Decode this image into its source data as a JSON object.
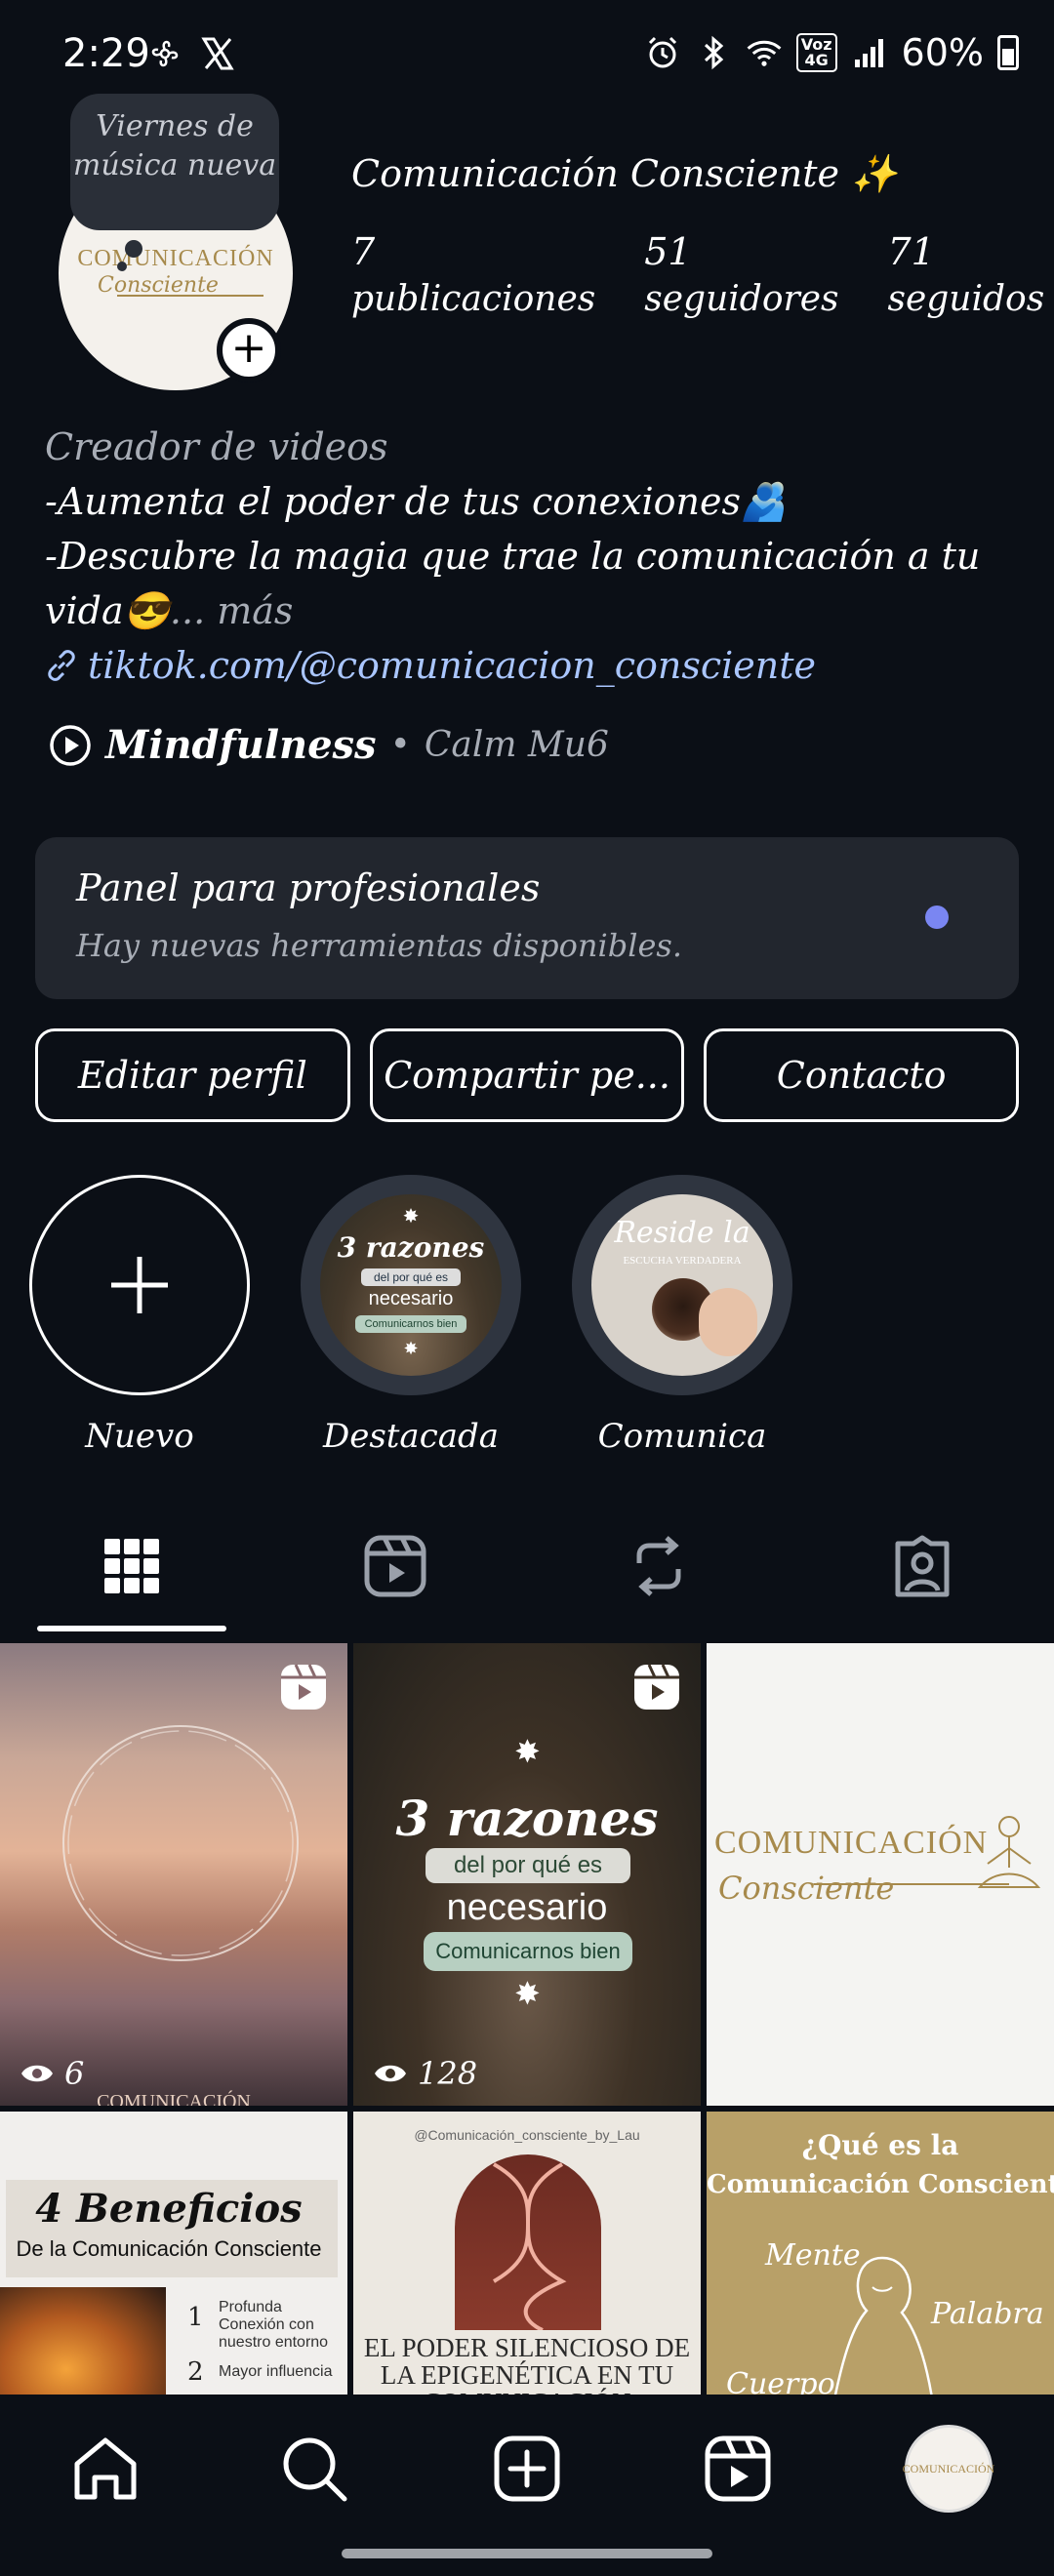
{
  "status_bar": {
    "time": "2:29",
    "battery": "60%",
    "network_badge_top": "Voz",
    "network_badge_bottom": "4G"
  },
  "profile": {
    "note": "Viernes de música nueva",
    "name": "Comunicación Consciente ✨",
    "avatar_logo_top": "COMUNICACIÓN",
    "avatar_logo_bottom": "Consciente",
    "stats": [
      {
        "value": "7",
        "label": "publicaciones"
      },
      {
        "value": "51",
        "label": "seguidores"
      },
      {
        "value": "71",
        "label": "seguidos"
      }
    ],
    "category": "Creador de videos",
    "bio_line1": "-Aumenta el poder de tus conexiones🫂",
    "bio_line2": "-Descubre la magia que trae la comunicación a tu",
    "bio_line3": "vida😎",
    "bio_more": "... más",
    "link": "tiktok.com/@comunicacion_consciente",
    "music_song": "Mindfulness",
    "music_sep": "•",
    "music_artist": "Calm Mu6"
  },
  "pro_panel": {
    "title": "Panel para profesionales",
    "subtitle": "Hay nuevas herramientas disponibles."
  },
  "actions": {
    "edit": "Editar perfil",
    "share": "Compartir pe...",
    "contact": "Contacto"
  },
  "highlights": [
    {
      "label": "Nuevo"
    },
    {
      "label": "Destacada"
    },
    {
      "label": "Comunica"
    }
  ],
  "highlight_art": {
    "destacada_title": "3 razones",
    "destacada_sub1": "del por qué es",
    "destacada_sub2": "necesario",
    "destacada_sub3": "Comunicarnos bien",
    "comunica_title": "Reside la",
    "comunica_sub": "ESCUCHA VERDADERA"
  },
  "grid": {
    "post1_views": "6",
    "post1_caption": "COMUNICACIÓN",
    "post2_views": "128",
    "post2_title": "3 razones",
    "post2_sub1": "del por qué es",
    "post2_sub2": "necesario",
    "post2_sub3": "Comunicarnos bien",
    "post3_l1": "COMUNICACIÓN",
    "post3_l2": "Consciente",
    "post4_title": "4 Beneficios",
    "post4_sub": "De la Comunicación Consciente",
    "post4_item1_num": "1",
    "post4_item1": "Profunda Conexión con nuestro entorno",
    "post4_item2_num": "2",
    "post4_item2": "Mayor influencia",
    "post5_handle": "@Comunicación_consciente_by_Lau",
    "post5_text": "EL PODER SILENCIOSO DE LA EPIGENÉTICA EN TU COMUNICACIÓN",
    "post6_l1": "¿Qué es la",
    "post6_l2": "Comunicación Consciente",
    "post6_w1": "Mente",
    "post6_w2": "Palabra",
    "post6_w3": "Cuerpo"
  },
  "nav": {
    "avatar_text": "COMUNICACIÓN"
  },
  "colors": {
    "background": "#0b0f16",
    "panel": "#22262e",
    "link": "#aac6ff",
    "gold": "#a78a4c",
    "dot": "#7a86f2"
  },
  "icons": [
    "alarm-icon",
    "bluetooth-icon",
    "wifi-icon",
    "signal-icon",
    "battery-icon",
    "fan-icon",
    "x-logo-icon",
    "link-icon",
    "play-circle-icon",
    "plus-icon",
    "grid-icon",
    "reels-icon",
    "repost-icon",
    "tagged-icon",
    "home-icon",
    "search-icon",
    "create-icon",
    "reels-nav-icon"
  ]
}
